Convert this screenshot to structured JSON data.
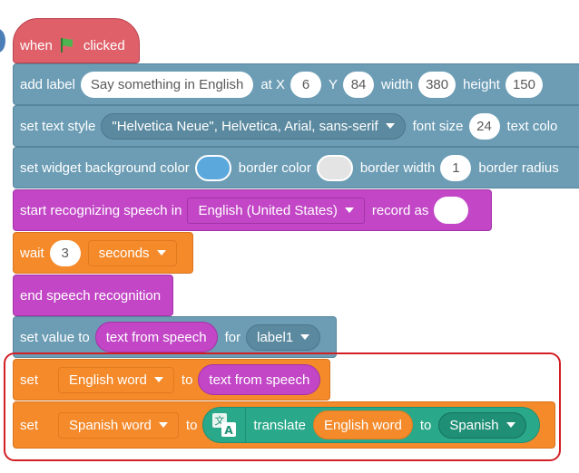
{
  "hat": {
    "when": "when",
    "clicked": "clicked",
    "flag_color": "#4fb34f"
  },
  "add_label": {
    "label": "add label",
    "text": "Say something in English",
    "at_x": "at X",
    "x": "6",
    "y_label": "Y",
    "y": "84",
    "width_label": "width",
    "width": "380",
    "height_label": "height",
    "height": "150"
  },
  "text_style": {
    "label": "set text style",
    "font": "\"Helvetica Neue\", Helvetica, Arial, sans-serif",
    "size_label": "font size",
    "size": "24",
    "color_label": "text colo"
  },
  "widget_bg": {
    "label": "set widget background color",
    "bg_color": "#5ba8dc",
    "border_color_label": "border color",
    "border_color": "#e4e4e4",
    "border_width_label": "border width",
    "border_width": "1",
    "border_radius_label": "border radius"
  },
  "start_speech": {
    "label": "start recognizing speech in",
    "language": "English (United States)",
    "record_as": "record as"
  },
  "wait": {
    "label": "wait",
    "value": "3",
    "unit": "seconds"
  },
  "end_speech": {
    "label": "end speech recognition"
  },
  "set_value": {
    "label": "set value to",
    "reporter": "text from speech",
    "for": "for",
    "target": "label1"
  },
  "set_english": {
    "set": "set",
    "variable": "English word",
    "to": "to",
    "reporter": "text from speech"
  },
  "set_spanish": {
    "set": "set",
    "variable": "Spanish word",
    "to": "to",
    "translate": "translate",
    "source": "English word",
    "to2": "to",
    "lang": "Spanish"
  },
  "colors": {
    "looks": "#6c9db5",
    "speech": "#c246c6",
    "control": "#f58a2b",
    "event": "#e0606a",
    "translate": "#2aa98a",
    "highlight": "#d21f25"
  }
}
